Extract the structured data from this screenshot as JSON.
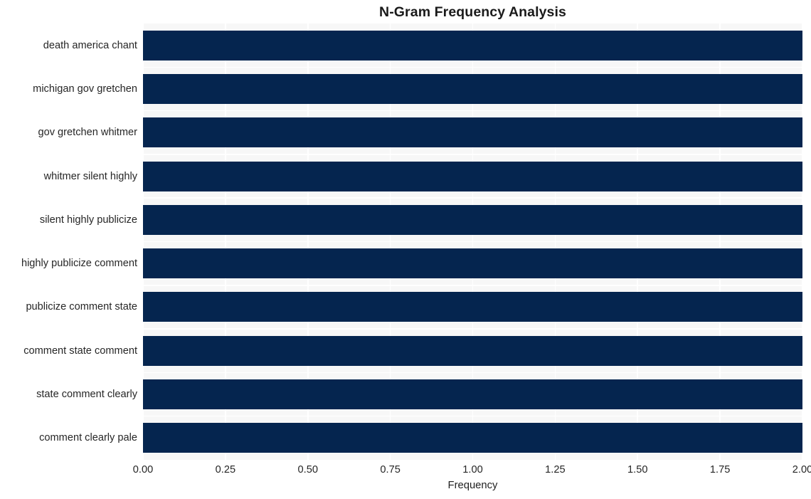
{
  "chart_data": {
    "type": "bar",
    "orientation": "horizontal",
    "title": "N-Gram Frequency Analysis",
    "xlabel": "Frequency",
    "ylabel": "",
    "xlim": [
      0,
      2
    ],
    "ylim": null,
    "grid": true,
    "legend": null,
    "bar_color": "#05254f",
    "plot_background": "#f7f7f7",
    "figure_background": "#ffffff",
    "xticks": [
      "0.00",
      "0.25",
      "0.50",
      "0.75",
      "1.00",
      "1.25",
      "1.50",
      "1.75",
      "2.00"
    ],
    "xtick_values": [
      0,
      0.25,
      0.5,
      0.75,
      1,
      1.25,
      1.5,
      1.75,
      2
    ],
    "categories": [
      "death america chant",
      "michigan gov gretchen",
      "gov gretchen whitmer",
      "whitmer silent highly",
      "silent highly publicize",
      "highly publicize comment",
      "publicize comment state",
      "comment state comment",
      "state comment clearly",
      "comment clearly pale"
    ],
    "values": [
      2,
      2,
      2,
      2,
      2,
      2,
      2,
      2,
      2,
      2
    ]
  }
}
